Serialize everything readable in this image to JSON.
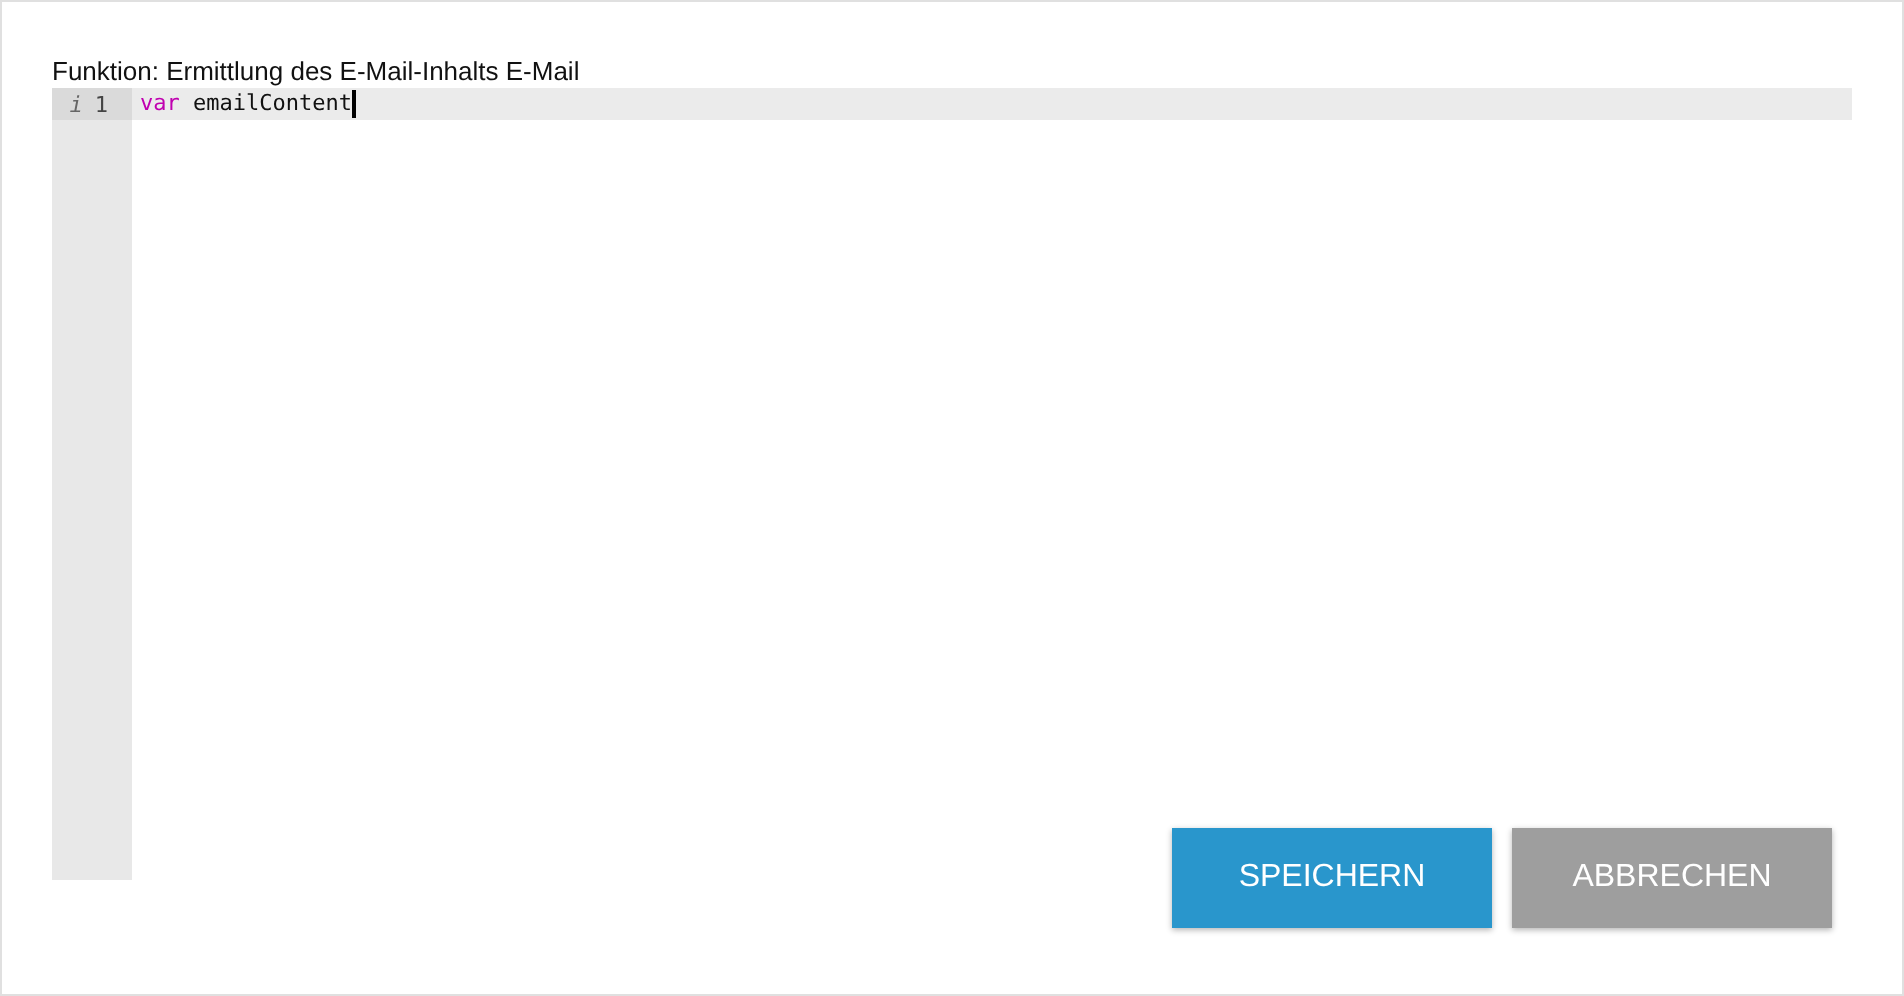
{
  "title": "Funktion: Ermittlung des E-Mail-Inhalts E-Mail",
  "editor": {
    "lines": [
      {
        "marker": "i",
        "number": "1",
        "active": true,
        "tokens": [
          {
            "kind": "keyword",
            "text": "var"
          },
          {
            "kind": "plain",
            "text": " emailContent"
          }
        ],
        "cursor": true
      }
    ]
  },
  "buttons": [
    {
      "label": "SPEICHERN",
      "kind": "primary"
    },
    {
      "label": "ABBRECHEN",
      "kind": "secondary"
    }
  ]
}
